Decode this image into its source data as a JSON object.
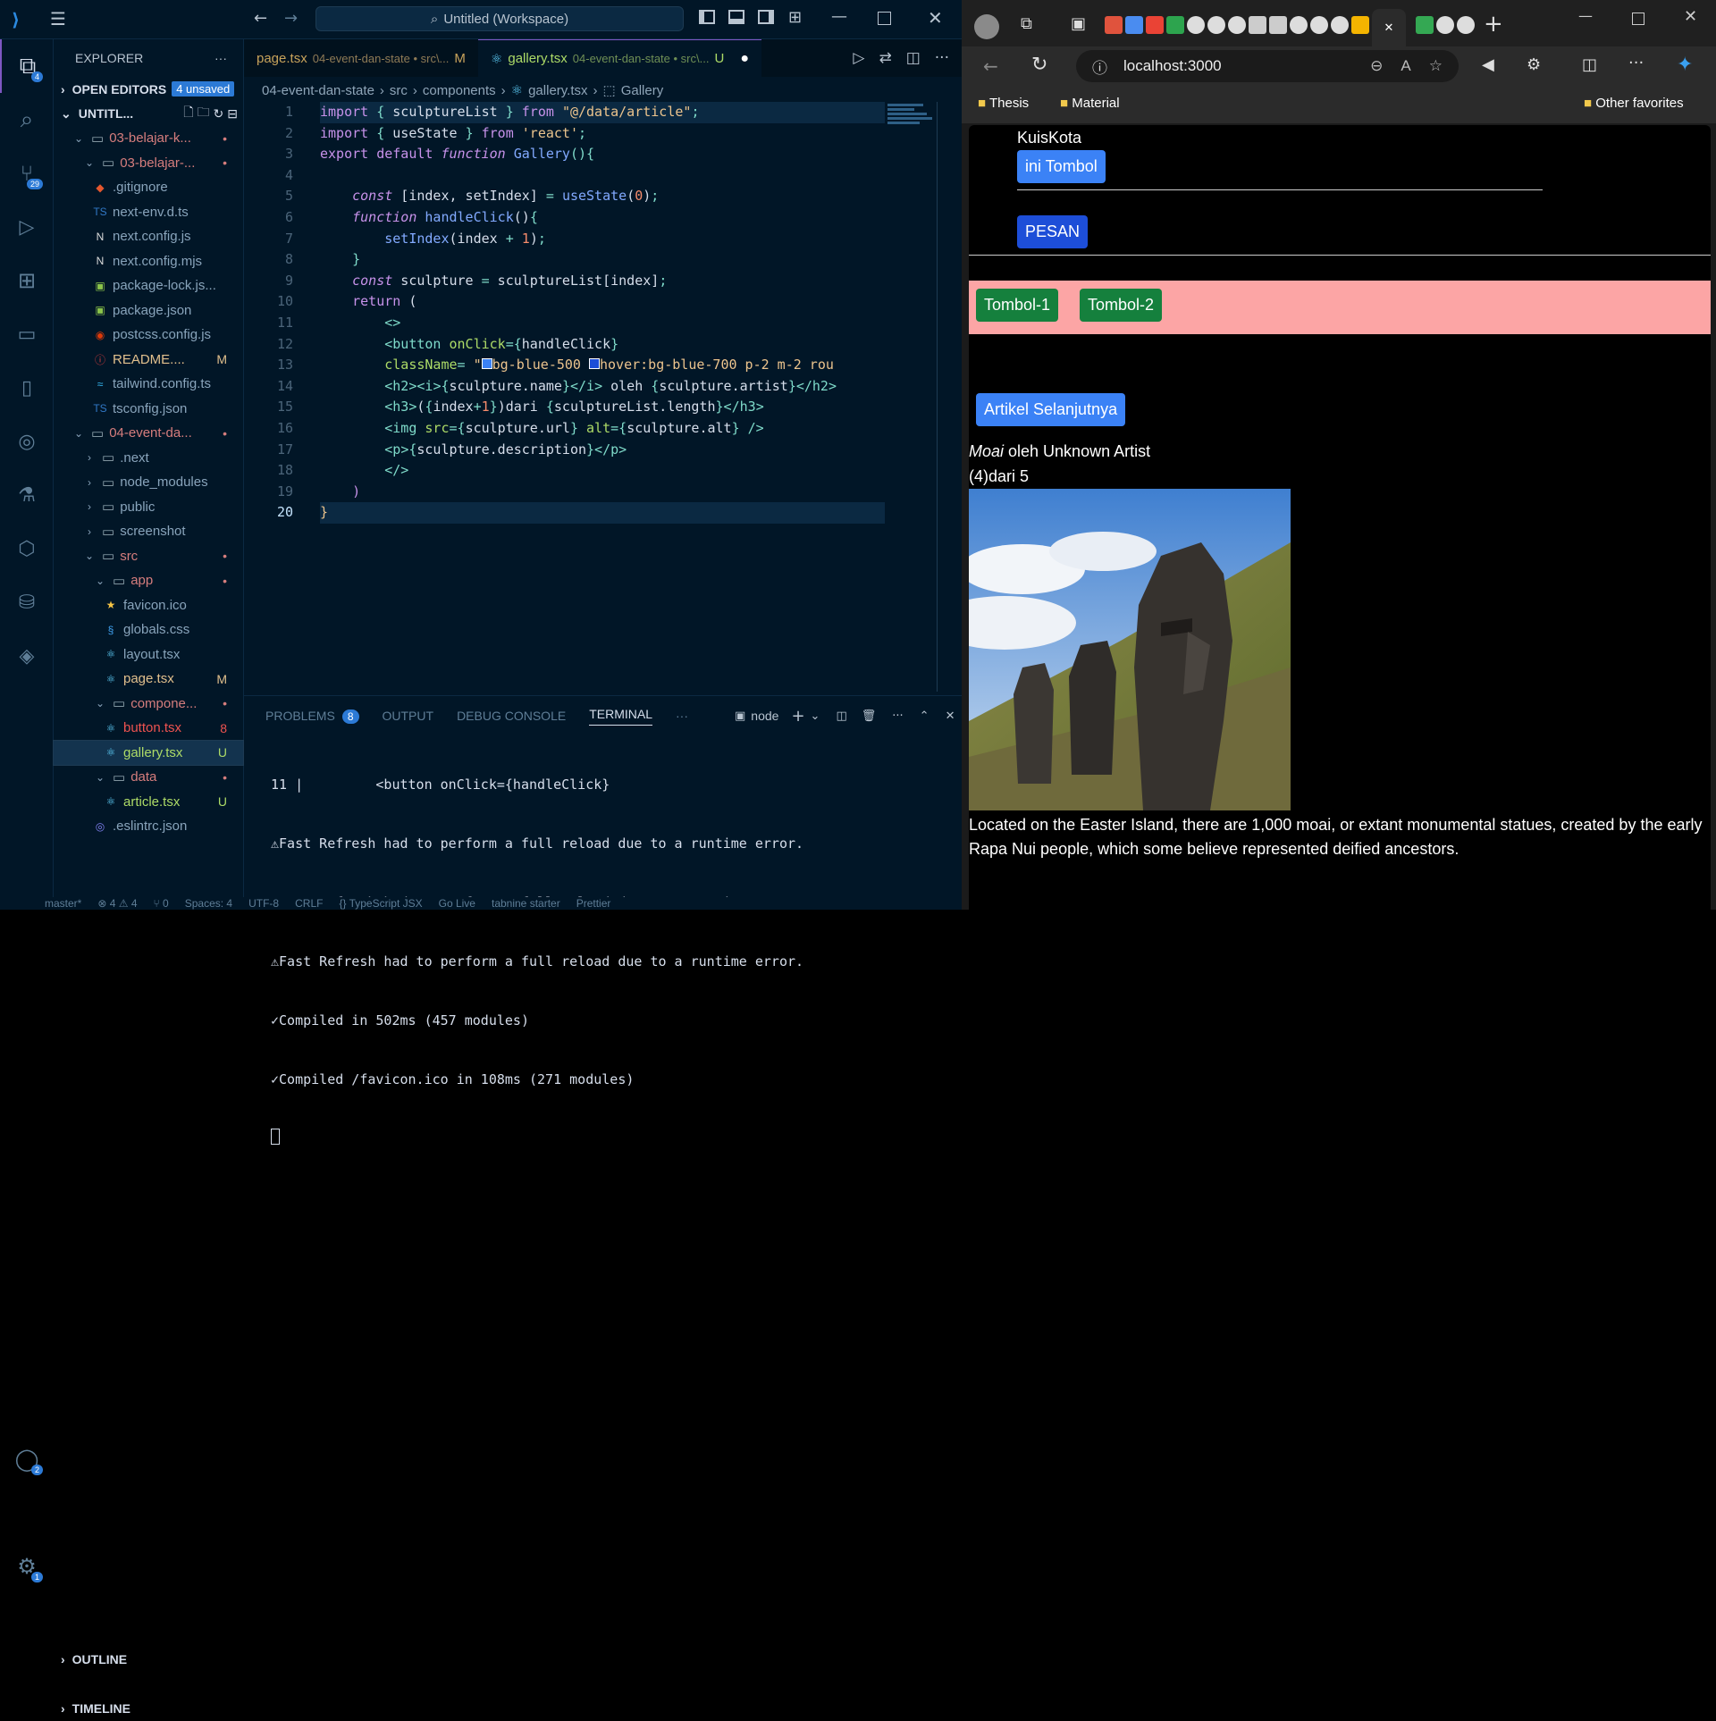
{
  "vscode": {
    "title": "Untitled (Workspace)",
    "activity_badges": {
      "explorer": "4",
      "source_control": "29",
      "accounts": "2",
      "settings": "1"
    },
    "sidebar": {
      "header": "EXPLORER",
      "open_editors": "OPEN EDITORS",
      "unsaved": "4 unsaved",
      "workspace": "UNTITL...",
      "items": [
        {
          "label": "03-belajar-k...",
          "indent": 1,
          "type": "folder-open",
          "status": "•"
        },
        {
          "label": "03-belajar-...",
          "indent": 2,
          "type": "folder-open",
          "status": "•"
        },
        {
          "label": ".gitignore",
          "indent": 3,
          "type": "git",
          "status": ""
        },
        {
          "label": "next-env.d.ts",
          "indent": 3,
          "type": "ts",
          "status": ""
        },
        {
          "label": "next.config.js",
          "indent": 3,
          "type": "next",
          "status": ""
        },
        {
          "label": "next.config.mjs",
          "indent": 3,
          "type": "next",
          "status": ""
        },
        {
          "label": "package-lock.js...",
          "indent": 3,
          "type": "npm",
          "status": ""
        },
        {
          "label": "package.json",
          "indent": 3,
          "type": "npm",
          "status": ""
        },
        {
          "label": "postcss.config.js",
          "indent": 3,
          "type": "postcss",
          "status": ""
        },
        {
          "label": "README....",
          "indent": 3,
          "type": "info",
          "status": "M"
        },
        {
          "label": "tailwind.config.ts",
          "indent": 3,
          "type": "tailwind",
          "status": ""
        },
        {
          "label": "tsconfig.json",
          "indent": 3,
          "type": "ts",
          "status": ""
        },
        {
          "label": "04-event-da...",
          "indent": 1,
          "type": "folder-open",
          "status": "•"
        },
        {
          "label": ".next",
          "indent": 2,
          "type": "folder",
          "status": ""
        },
        {
          "label": "node_modules",
          "indent": 2,
          "type": "folder",
          "status": ""
        },
        {
          "label": "public",
          "indent": 2,
          "type": "folder",
          "status": ""
        },
        {
          "label": "screenshot",
          "indent": 2,
          "type": "folder",
          "status": ""
        },
        {
          "label": "src",
          "indent": 2,
          "type": "folder-open",
          "status": "•"
        },
        {
          "label": "app",
          "indent": 3,
          "type": "folder-open",
          "status": "•"
        },
        {
          "label": "favicon.ico",
          "indent": 4,
          "type": "star",
          "status": ""
        },
        {
          "label": "globals.css",
          "indent": 4,
          "type": "css",
          "status": ""
        },
        {
          "label": "layout.tsx",
          "indent": 4,
          "type": "react",
          "status": ""
        },
        {
          "label": "page.tsx",
          "indent": 4,
          "type": "react",
          "status": "M"
        },
        {
          "label": "compone...",
          "indent": 3,
          "type": "folder-open",
          "status": "•"
        },
        {
          "label": "button.tsx",
          "indent": 4,
          "type": "react",
          "status": "8"
        },
        {
          "label": "gallery.tsx",
          "indent": 4,
          "type": "react",
          "status": "U"
        },
        {
          "label": "data",
          "indent": 3,
          "type": "folder-open",
          "status": "•"
        },
        {
          "label": "article.tsx",
          "indent": 4,
          "type": "react",
          "status": "U"
        },
        {
          "label": ".eslintrc.json",
          "indent": 3,
          "type": "eslint",
          "status": ""
        }
      ],
      "outline": "OUTLINE",
      "timeline": "TIMELINE"
    },
    "tabs": [
      {
        "name": "page.tsx",
        "path": "04-event-dan-state • src\\...",
        "status": "M"
      },
      {
        "name": "gallery.tsx",
        "path": "04-event-dan-state • src\\...",
        "status": "U"
      }
    ],
    "breadcrumb": [
      "04-event-dan-state",
      "src",
      "components",
      "gallery.tsx",
      "Gallery"
    ],
    "panel": {
      "tabs": [
        "PROBLEMS",
        "OUTPUT",
        "DEBUG CONSOLE",
        "TERMINAL"
      ],
      "problems_count": "8",
      "terminal_name": "node",
      "lines": [
        "11 |         <button onClick={handleClick}",
        "⚠Fast Refresh had to perform a full reload due to a runtime error.",
        "⚠Fast Refresh had to perform a full reload due to a runtime error.",
        "⚠Fast Refresh had to perform a full reload due to a runtime error.",
        "✓Compiled in 502ms (457 modules)",
        "✓Compiled /favicon.ico in 108ms (271 modules)"
      ]
    },
    "status": [
      "master*",
      "⊗ 4 ⚠ 4",
      "⑂ 0",
      "Spaces: 4",
      "UTF-8",
      "CRLF",
      "{} TypeScript JSX",
      "Go Live",
      "tabnine starter",
      "Prettier"
    ]
  },
  "browser": {
    "url": "localhost:3000",
    "favorites": [
      "Thesis",
      "Material"
    ],
    "other_favorites": "Other favorites",
    "page": {
      "brand": "KuisKota",
      "btn1": "ini Tombol",
      "btn2": "PESAN",
      "tombol1": "Tombol-1",
      "tombol2": "Tombol-2",
      "next": "Artikel Selanjutnya",
      "name": "Moai",
      "oleh": " oleh Unknown Artist",
      "counter": "(4)dari 5",
      "description": "Located on the Easter Island, there are 1,000 moai, or extant monumental statues, created by the early Rapa Nui people, which some believe represented deified ancestors."
    }
  }
}
